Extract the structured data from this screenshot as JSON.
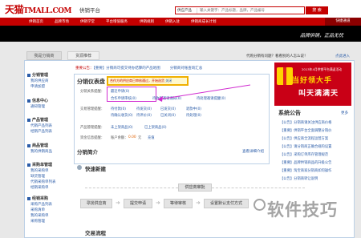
{
  "header": {
    "logo": "天猫",
    "logo_domain": "TMALL.COM",
    "platform": "供销平台",
    "search_type": "供应产品",
    "search_placeholder": "输入关键字：产品标题，品牌，产品编号",
    "search_button": "搜 索"
  },
  "nav": {
    "items": [
      "供销首页",
      "品牌市场",
      "供销学堂",
      "平台增值服务",
      "供销规则",
      "供销入驻",
      "供销商成长计划"
    ],
    "quick": "快捷通道"
  },
  "slogan": "品牌供销，正品无忧",
  "tabs": {
    "active": "我是分销商",
    "other": "货源推荐"
  },
  "top_tip": {
    "text": "代购分销有问题？看看别的人怎么说！",
    "link": "点此进入"
  },
  "sidebar": [
    {
      "title": "分销管理",
      "links": [
        "我的供应商",
        "申请加盟"
      ]
    },
    {
      "title": "信息中心",
      "links": [
        "通知管理"
      ]
    },
    {
      "title": "产品管理",
      "links": [
        "代销产品列表",
        "经销产品列表"
      ]
    },
    {
      "title": "商品管理",
      "links": [
        "我的供销商品"
      ]
    },
    {
      "title": "采购单管理",
      "links": [
        "我的采购单",
        "缺货管理",
        "代销采购单列表",
        "经销采购单"
      ]
    },
    {
      "title": "经销采购",
      "links": [
        "采购产品列表",
        "采购清单",
        "我的采购单",
        "采购管理"
      ]
    }
  ],
  "notice": {
    "label": "重要公告：",
    "items": [
      "【重要】分销商可提交待办结算的产品地图",
      "分销商对账查询汇总"
    ]
  },
  "dashboard": {
    "title": "分销仪表盘",
    "tooltip": "合作方的供应商已审核通过，开始选货",
    "tooltip_close": "关闭",
    "rows": [
      {
        "label": "分销关系提醒：",
        "cols": [
          "最近申请(0)",
          "",
          ""
        ]
      },
      {
        "label": "",
        "cols": [
          "合作申请审核(0)",
          "待收到邀请通知(0)",
          "待处理邀请提醒(0)"
        ]
      },
      {
        "label": "交易管理提醒：",
        "cols": [
          "待付款(0)",
          "待发货(0)",
          "已发货(0)",
          "退款中(0)"
        ]
      },
      {
        "label": "",
        "cols": [
          "待确认收货(0)",
          "待评价(0)",
          "已关闭(0)",
          "待处理(0)"
        ]
      },
      {
        "label": "产品管理提醒：",
        "cols": [
          "未上架商品(0)",
          "已上架商品(0)"
        ]
      },
      {
        "label": "资金信息提醒：",
        "cols": [
          "账户余额：",
          "0.00",
          "元",
          "充值"
        ]
      }
    ]
  },
  "intro": {
    "title": "分销简介",
    "link": "查看详细介绍"
  },
  "quick_start": "快速新建",
  "flow": {
    "top": "供应商审批",
    "steps": [
      "寻找供应商",
      "提交申请",
      "等待审核",
      "设置默认支付方式"
    ]
  },
  "trade_process": "交易流程",
  "banner": {
    "sub": "2013年4月供销平台满返活动",
    "line1": "当好领大手",
    "line2": "叫天满满天"
  },
  "sysinfo": {
    "title": "系统公告",
    "more": "更多",
    "items": [
      "【公告】分销商请关注供应商价格",
      "【重要】供销平台全面调整分销价",
      "【公告】供应商全流程运营方案",
      "【公告】请分销商正确合规的设置",
      "【公告】采购订单库存管理规范",
      "【重要】品牌供销商品的升级公告",
      "【重要】淘宝商家分销商如何操作",
      "【公告】分销商转让说明"
    ]
  },
  "watermark": "软件技巧"
}
